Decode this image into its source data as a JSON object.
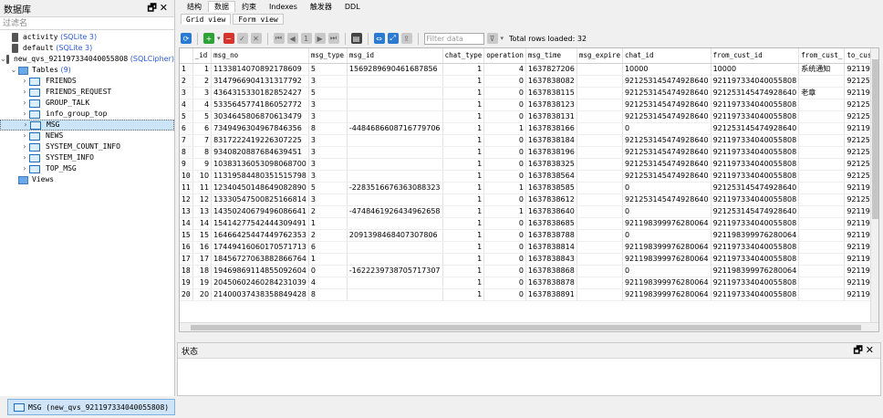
{
  "left_panel": {
    "title": "数据库",
    "filter_placeholder": "过滤名",
    "databases": [
      {
        "name": "activity",
        "type": "(SQLite 3)"
      },
      {
        "name": "default",
        "type": "(SQLite 3)"
      },
      {
        "name": "new_qvs_921197334040055808",
        "type": "(SQLCipher)"
      }
    ],
    "tables_label": "Tables",
    "tables_count": "(9)",
    "tables": [
      "FRIENDS",
      "FRIENDS_REQUEST",
      "GROUP_TALK",
      "info_group_top",
      "MSG",
      "NEWS",
      "SYSTEM_COUNT_INFO",
      "SYSTEM_INFO",
      "TOP_MSG"
    ],
    "selected_table": "MSG",
    "views_label": "Views"
  },
  "tabs": [
    "结构",
    "数据",
    "约束",
    "Indexes",
    "触发器",
    "DDL"
  ],
  "active_tab": "数据",
  "subtabs": [
    "Grid view",
    "Form view"
  ],
  "toolbar": {
    "filter_placeholder": "Filter data",
    "total_label": "Total rows loaded: 32",
    "page_number": "1"
  },
  "grid": {
    "columns": [
      "_id",
      "msg_no",
      "msg_type",
      "msg_id",
      "chat_type",
      "operation",
      "msg_time",
      "msg_expire",
      "chat_id",
      "from_cust_id",
      "from_cust_",
      "to_cust"
    ],
    "rows": [
      [
        "1",
        "1133814070892178609",
        "5",
        "1569289690461687856",
        "1",
        "4",
        "1637827206",
        "",
        "10000",
        "10000",
        "系统通知",
        "92119"
      ],
      [
        "2",
        "3147966904131317792",
        "3",
        "",
        "1",
        "0",
        "1637838082",
        "",
        "921253145474928640",
        "921197334040055808",
        "",
        "92125"
      ],
      [
        "3",
        "4364315330182852427",
        "5",
        "",
        "1",
        "0",
        "1637838115",
        "",
        "921253145474928640",
        "921253145474928640",
        "老章",
        "92119"
      ],
      [
        "4",
        "5335645774186052772",
        "3",
        "",
        "1",
        "0",
        "1637838123",
        "",
        "921253145474928640",
        "921197334040055808",
        "",
        "92125"
      ],
      [
        "5",
        "3034645806870613479",
        "3",
        "",
        "1",
        "0",
        "1637838131",
        "",
        "921253145474928640",
        "921197334040055808",
        "",
        "92125"
      ],
      [
        "6",
        "7349496304967846356",
        "8",
        "-4484686608716779706",
        "1",
        "1",
        "1637838166",
        "",
        "0",
        "921253145474928640",
        "",
        "92119"
      ],
      [
        "7",
        "8317222419226307225",
        "3",
        "",
        "1",
        "0",
        "1637838184",
        "",
        "921253145474928640",
        "921197334040055808",
        "",
        "92125"
      ],
      [
        "8",
        "9340820887684639451",
        "3",
        "",
        "1",
        "0",
        "1637838196",
        "",
        "921253145474928640",
        "921197334040055808",
        "",
        "92125"
      ],
      [
        "9",
        "10383136053098068700",
        "3",
        "",
        "1",
        "0",
        "1637838325",
        "",
        "921253145474928640",
        "921197334040055808",
        "",
        "92125"
      ],
      [
        "10",
        "11319584480351515798",
        "3",
        "",
        "1",
        "0",
        "1637838564",
        "",
        "921253145474928640",
        "921197334040055808",
        "",
        "92125"
      ],
      [
        "11",
        "12340450148649082890",
        "5",
        "-2283516676363088323",
        "1",
        "1",
        "1637838585",
        "",
        "0",
        "921253145474928640",
        "",
        "92119"
      ],
      [
        "12",
        "13330547500825166814",
        "3",
        "",
        "1",
        "0",
        "1637838612",
        "",
        "921253145474928640",
        "921197334040055808",
        "",
        "92125"
      ],
      [
        "13",
        "14350240679496086641",
        "2",
        "-4748461926434962658",
        "1",
        "1",
        "1637838640",
        "",
        "0",
        "921253145474928640",
        "",
        "92119"
      ],
      [
        "14",
        "15414277542444309491",
        "1",
        "",
        "1",
        "0",
        "1637838685",
        "",
        "921198399976280064",
        "921197334040055808",
        "",
        "92119"
      ],
      [
        "15",
        "16466425447449762353",
        "2",
        "2091398468407307806",
        "1",
        "0",
        "1637838788",
        "",
        "0",
        "921198399976280064",
        "",
        "92119"
      ],
      [
        "16",
        "17449416060170571713",
        "6",
        "",
        "1",
        "0",
        "1637838814",
        "",
        "921198399976280064",
        "921197334040055808",
        "",
        "92119"
      ],
      [
        "17",
        "18456727063882866764",
        "1",
        "",
        "1",
        "0",
        "1637838843",
        "",
        "921198399976280064",
        "921197334040055808",
        "",
        "92119"
      ],
      [
        "18",
        "19469869114855092604",
        "0",
        "-1622239738705717307",
        "1",
        "0",
        "1637838868",
        "",
        "0",
        "921198399976280064",
        "",
        "92119"
      ],
      [
        "19",
        "20450602460284231039",
        "4",
        "",
        "1",
        "0",
        "1637838878",
        "",
        "921198399976280064",
        "921197334040055808",
        "",
        "92119"
      ],
      [
        "20",
        "21400037438358849428",
        "8",
        "",
        "1",
        "0",
        "1637838891",
        "",
        "921198399976280064",
        "921197334040055808",
        "",
        "92119"
      ]
    ]
  },
  "status_panel": {
    "title": "状态"
  },
  "bottom_tab": {
    "label": "MSG (new_qvs_921197334040055808)"
  }
}
